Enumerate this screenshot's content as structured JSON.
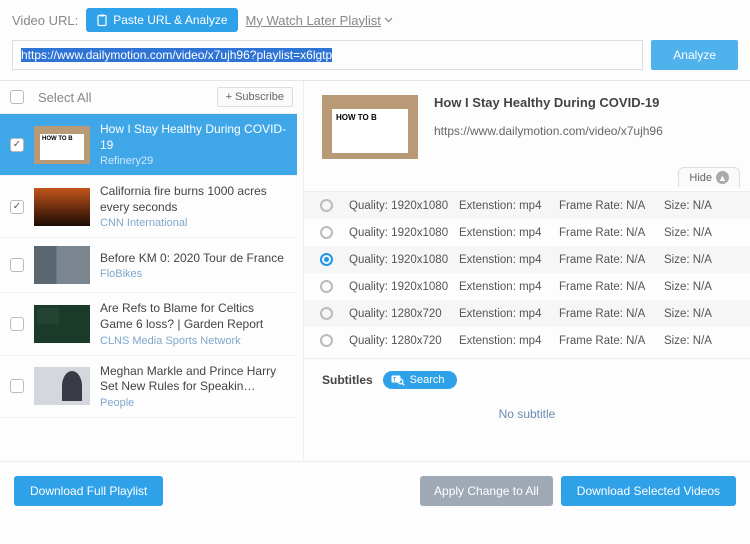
{
  "top": {
    "url_label": "Video URL:",
    "paste_btn": "Paste URL & Analyze",
    "watch_later": "My Watch Later Playlist",
    "url_value": "https://www.dailymotion.com/video/x7ujh96?playlist=x6lgtp",
    "analyze": "Analyze"
  },
  "left": {
    "select_all": "Select All",
    "subscribe": "Subscribe",
    "items": [
      {
        "title": "How I Stay Healthy During COVID-19",
        "source": "Refinery29",
        "checked": true,
        "selected": true,
        "thumb": "howto"
      },
      {
        "title": "California fire burns 1000 acres every seconds",
        "source": "CNN International",
        "checked": true,
        "selected": false,
        "thumb": "fire"
      },
      {
        "title": "Before KM 0: 2020 Tour de France",
        "source": "FloBikes",
        "checked": false,
        "selected": false,
        "thumb": "tour"
      },
      {
        "title": "Are Refs to Blame for Celtics Game 6 loss? | Garden Report",
        "source": "CLNS Media Sports Network",
        "checked": false,
        "selected": false,
        "thumb": "celtics"
      },
      {
        "title": "Meghan Markle and Prince Harry Set New Rules for Speakin…",
        "source": "People",
        "checked": false,
        "selected": false,
        "thumb": "meghan"
      }
    ]
  },
  "detail": {
    "title": "How I Stay Healthy During COVID-19",
    "url": "https://www.dailymotion.com/video/x7ujh96",
    "hide": "Hide",
    "qualities": [
      {
        "q": "Quality: 1920x1080",
        "e": "Extenstion: mp4",
        "f": "Frame Rate: N/A",
        "s": "Size: N/A",
        "on": false,
        "alt": true
      },
      {
        "q": "Quality: 1920x1080",
        "e": "Extenstion: mp4",
        "f": "Frame Rate: N/A",
        "s": "Size: N/A",
        "on": false,
        "alt": false
      },
      {
        "q": "Quality: 1920x1080",
        "e": "Extenstion: mp4",
        "f": "Frame Rate: N/A",
        "s": "Size: N/A",
        "on": true,
        "alt": true
      },
      {
        "q": "Quality: 1920x1080",
        "e": "Extenstion: mp4",
        "f": "Frame Rate: N/A",
        "s": "Size: N/A",
        "on": false,
        "alt": false
      },
      {
        "q": "Quality: 1280x720",
        "e": "Extenstion: mp4",
        "f": "Frame Rate: N/A",
        "s": "Size: N/A",
        "on": false,
        "alt": true
      },
      {
        "q": "Quality: 1280x720",
        "e": "Extenstion: mp4",
        "f": "Frame Rate: N/A",
        "s": "Size: N/A",
        "on": false,
        "alt": false
      }
    ],
    "subtitles_label": "Subtitles",
    "search": "Search",
    "no_subtitle": "No subtitle"
  },
  "bottom": {
    "dl_full": "Download Full Playlist",
    "apply": "Apply Change to All",
    "dl_sel": "Download Selected Videos"
  }
}
